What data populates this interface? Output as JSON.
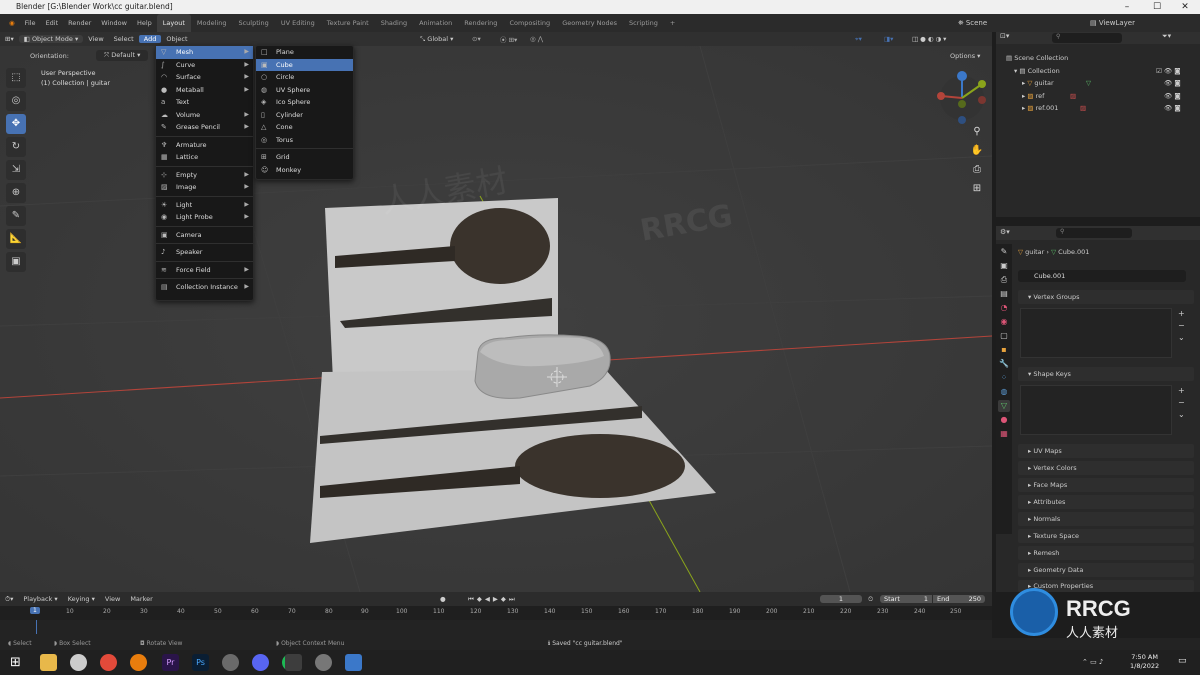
{
  "window": {
    "title": "Blender [G:\\Blender Work\\cc guitar.blend]"
  },
  "topbar": {
    "menus": [
      "File",
      "Edit",
      "Render",
      "Window",
      "Help"
    ],
    "workspaces": [
      "Layout",
      "Modeling",
      "Sculpting",
      "UV Editing",
      "Texture Paint",
      "Shading",
      "Animation",
      "Rendering",
      "Compositing",
      "Geometry Nodes",
      "Scripting"
    ],
    "active_workspace": "Layout",
    "scene": "Scene",
    "view_layer": "ViewLayer"
  },
  "viewport_header": {
    "mode": "Object Mode",
    "menus": [
      "View",
      "Select",
      "Add",
      "Object"
    ],
    "orientation_label": "Orientation:",
    "orientation_value": "Default",
    "transform": "Global",
    "options": "Options"
  },
  "viewport": {
    "perspective": "User Perspective",
    "collection_info": "(1) Collection | guitar"
  },
  "add_menu": {
    "items": [
      {
        "label": "Mesh",
        "icon": "mesh-icon",
        "sub": true
      },
      {
        "label": "Curve",
        "icon": "curve-icon",
        "sub": true
      },
      {
        "label": "Surface",
        "icon": "surface-icon",
        "sub": true
      },
      {
        "label": "Metaball",
        "icon": "metaball-icon",
        "sub": true
      },
      {
        "label": "Text",
        "icon": "text-icon",
        "sub": false
      },
      {
        "label": "Volume",
        "icon": "volume-icon",
        "sub": true
      },
      {
        "label": "Grease Pencil",
        "icon": "grease-pencil-icon",
        "sub": true
      },
      {
        "label": "Armature",
        "icon": "armature-icon",
        "sub": false
      },
      {
        "label": "Lattice",
        "icon": "lattice-icon",
        "sub": false
      },
      {
        "label": "Empty",
        "icon": "empty-icon",
        "sub": true
      },
      {
        "label": "Image",
        "icon": "image-icon",
        "sub": true
      },
      {
        "label": "Light",
        "icon": "light-icon",
        "sub": true
      },
      {
        "label": "Light Probe",
        "icon": "light-probe-icon",
        "sub": true
      },
      {
        "label": "Camera",
        "icon": "camera-icon",
        "sub": false
      },
      {
        "label": "Speaker",
        "icon": "speaker-icon",
        "sub": false
      },
      {
        "label": "Force Field",
        "icon": "force-field-icon",
        "sub": true
      },
      {
        "label": "Collection Instance",
        "icon": "collection-icon",
        "sub": true
      }
    ]
  },
  "mesh_submenu": {
    "items": [
      "Plane",
      "Cube",
      "Circle",
      "UV Sphere",
      "Ico Sphere",
      "Cylinder",
      "Cone",
      "Torus",
      "Grid",
      "Monkey"
    ],
    "highlighted": "Cube"
  },
  "outliner": {
    "root": "Scene Collection",
    "items": [
      {
        "label": "Collection"
      },
      {
        "label": "guitar"
      },
      {
        "label": "ref"
      },
      {
        "label": "ref.001"
      }
    ]
  },
  "properties": {
    "breadcrumb_object": "guitar",
    "breadcrumb_data": "Cube.001",
    "data_name": "Cube.001",
    "panels": [
      "Vertex Groups",
      "Shape Keys",
      "UV Maps",
      "Vertex Colors",
      "Face Maps",
      "Attributes",
      "Normals",
      "Texture Space",
      "Remesh",
      "Geometry Data",
      "Custom Properties"
    ]
  },
  "timeline": {
    "menus": [
      "Playback",
      "Keying",
      "View",
      "Marker"
    ],
    "current_frame": "1",
    "start_label": "Start",
    "start": "1",
    "end_label": "End",
    "end": "250",
    "ticks": [
      "1",
      "10",
      "20",
      "30",
      "40",
      "50",
      "60",
      "70",
      "80",
      "90",
      "100",
      "110",
      "120",
      "130",
      "140",
      "150",
      "160",
      "170",
      "180",
      "190",
      "200",
      "210",
      "220",
      "230",
      "240",
      "250"
    ]
  },
  "statusbar": {
    "select": "Select",
    "box_select": "Box Select",
    "rotate_view": "Rotate View",
    "context_menu": "Object Context Menu",
    "saved": "Saved \"cc guitar.blend\""
  },
  "taskbar": {
    "time": "7:50 AM",
    "date": "1/8/2022"
  },
  "watermark": {
    "brand": "RRCG",
    "chinese": "人人素材"
  },
  "colors": {
    "accent": "#4772b3",
    "x_axis": "#b3443a",
    "y_axis": "#8aa41b",
    "background": "#3a3a3a"
  }
}
